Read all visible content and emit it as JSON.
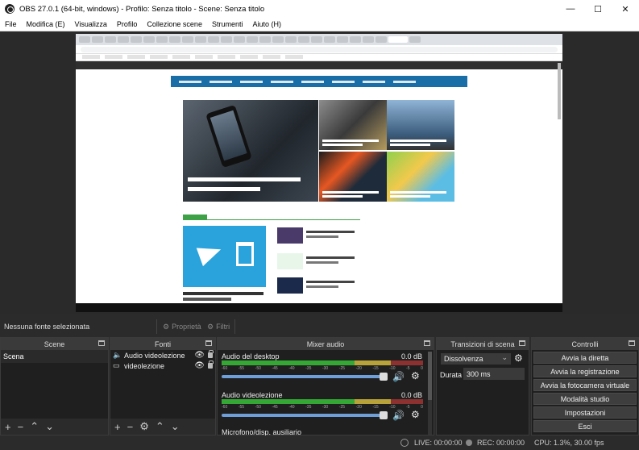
{
  "window": {
    "title": "OBS 27.0.1 (64-bit, windows) - Profilo: Senza titolo - Scene: Senza titolo",
    "minimize": "—",
    "maximize": "☐",
    "close": "✕"
  },
  "menu": [
    "File",
    "Modifica (E)",
    "Visualizza",
    "Profilo",
    "Collezione scene",
    "Strumenti",
    "Aiuto (H)"
  ],
  "source_bar": {
    "no_selection": "Nessuna fonte selezionata",
    "properties": "Proprietà",
    "filters": "Filtri"
  },
  "scenes": {
    "title": "Scene",
    "items": [
      "Scena"
    ]
  },
  "sources": {
    "title": "Fonti",
    "items": [
      {
        "name": "Audio videolezione",
        "icon": "speaker-icon"
      },
      {
        "name": "videolezione",
        "icon": "window-capture-icon"
      }
    ]
  },
  "mixer": {
    "title": "Mixer audio",
    "channels": [
      {
        "name": "Audio del desktop",
        "db": "0.0 dB"
      },
      {
        "name": "Audio videolezione",
        "db": "0.0 dB"
      }
    ],
    "partial_channel": "Microfono/disp. ausiliario",
    "scale": [
      "-60",
      "-55",
      "-50",
      "-45",
      "-40",
      "-35",
      "-30",
      "-25",
      "-20",
      "-15",
      "-10",
      "-5",
      "0"
    ]
  },
  "transitions": {
    "title": "Transizioni di scena",
    "selected": "Dissolvenza",
    "duration_label": "Durata",
    "duration_value": "300 ms"
  },
  "controls": {
    "title": "Controlli",
    "buttons": [
      "Avvia la diretta",
      "Avvia la registrazione",
      "Avvia la fotocamera virtuale",
      "Modalità studio",
      "Impostazioni",
      "Esci"
    ]
  },
  "status": {
    "live": "LIVE: 00:00:00",
    "rec": "REC: 00:00:00",
    "cpu": "CPU: 1.3%, 30.00 fps"
  },
  "colors": {
    "meter_green": "#35a735",
    "meter_yellow": "#b8a23a",
    "meter_red": "#8c3030",
    "fader_blue": "#6f9fd8"
  }
}
